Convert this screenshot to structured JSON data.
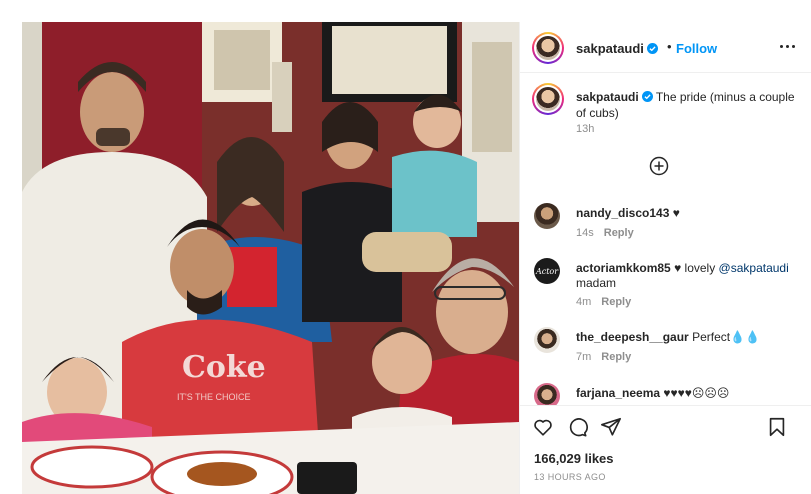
{
  "post": {
    "username": "sakpataudi",
    "follow_label": "Follow",
    "separator": "•",
    "caption_text": "The pride (minus a couple of cubs)",
    "caption_time": "13h",
    "likes": "166,029 likes",
    "posted_ago": "13 HOURS AGO",
    "photo_shirt_text": "Coke",
    "photo_shirt_subtext": "IT'S THE CHOICE"
  },
  "comments": [
    {
      "username": "nandy_disco143",
      "text": "♥",
      "time": "14s",
      "reply": "Reply"
    },
    {
      "username": "actoriamkkom85",
      "text": "♥ lovely ",
      "mention": "@sakpataudi",
      "text2": " madam",
      "time": "4m",
      "reply": "Reply",
      "avatar_label": "Actor"
    },
    {
      "username": "the_deepesh__gaur",
      "text": "Perfect💧💧",
      "time": "7m",
      "reply": "Reply"
    },
    {
      "username": "farjana_neema",
      "text": "♥♥♥♥☹☹☹",
      "time": "",
      "reply": ""
    }
  ],
  "icons": [
    "verified-badge-icon",
    "more-options-icon",
    "add-comment-icon",
    "heart-icon",
    "comment-icon",
    "share-icon",
    "bookmark-icon"
  ],
  "colors": {
    "follow": "#0095f6",
    "verified": "#0095f6",
    "text": "#262626",
    "muted": "#8e8e8e"
  }
}
